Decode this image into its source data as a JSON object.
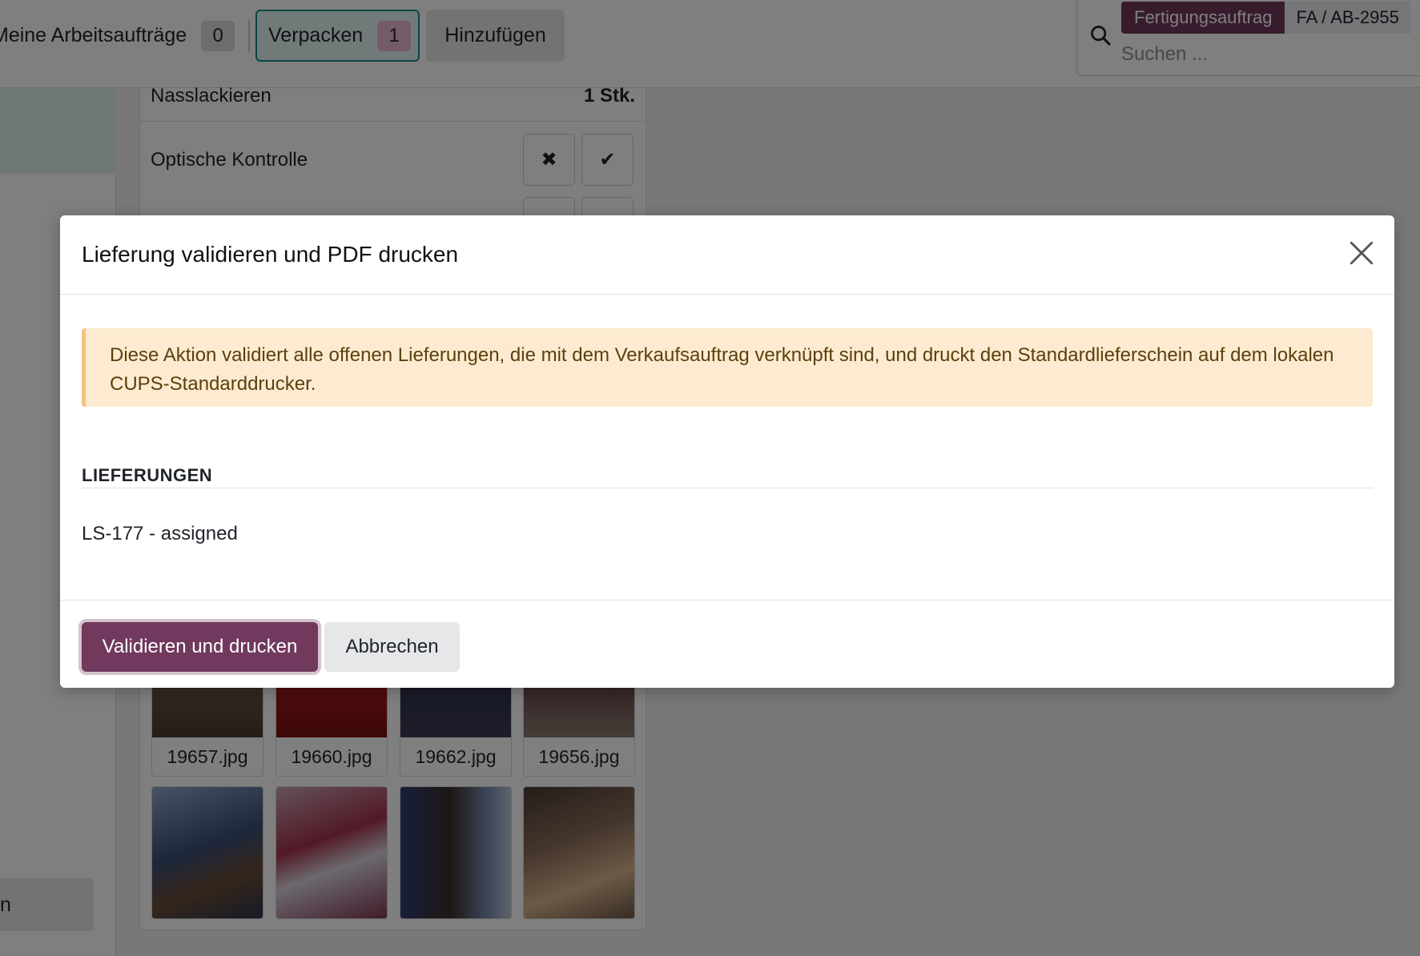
{
  "topbar": {
    "tabs": [
      {
        "label": "Meine Arbeitsaufträge",
        "count": "0"
      },
      {
        "label": "Verpacken",
        "count": "1"
      },
      {
        "label": "Hinzufügen"
      }
    ],
    "search": {
      "facet_key": "Fertigungsauftrag",
      "facet_value": "FA / AB-2955",
      "placeholder": "Suchen ..."
    }
  },
  "background": {
    "rows": [
      {
        "label": "Nasslackieren",
        "qty": "1 Stk."
      },
      {
        "label": "Optische Kontrolle"
      }
    ],
    "left_button_label": "n",
    "attachments": [
      "19657.jpg",
      "19660.jpg",
      "19662.jpg",
      "19656.jpg"
    ]
  },
  "modal": {
    "title": "Lieferung validieren und PDF drucken",
    "alert": "Diese Aktion validiert alle offenen Lieferungen, die mit dem Verkaufsauftrag verknüpft sind, und druckt den Standardlieferschein auf dem lokalen CUPS-Standarddrucker.",
    "section_title": "LIEFERUNGEN",
    "deliveries": [
      "LS-177 - assigned"
    ],
    "primary_button": "Validieren und drucken",
    "secondary_button": "Abbrechen"
  },
  "colors": {
    "brand": "#71395d",
    "teal": "#0f8b8d",
    "warning_bg": "#fcebd0"
  }
}
